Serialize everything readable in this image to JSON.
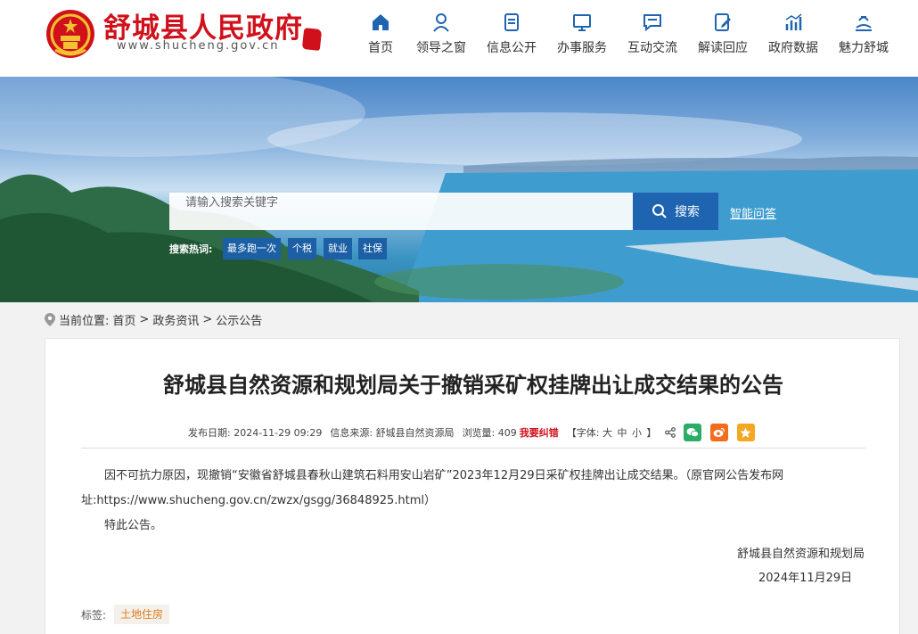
{
  "site": {
    "title": "舒城县人民政府",
    "domain": "www.shucheng.gov.cn",
    "seal_text": "舒城"
  },
  "nav": {
    "items": [
      {
        "label": "首页",
        "icon": "home-icon"
      },
      {
        "label": "领导之窗",
        "icon": "person-icon"
      },
      {
        "label": "信息公开",
        "icon": "document-icon"
      },
      {
        "label": "办事服务",
        "icon": "monitor-icon"
      },
      {
        "label": "互动交流",
        "icon": "chat-icon"
      },
      {
        "label": "解读回应",
        "icon": "edit-icon"
      },
      {
        "label": "政府数据",
        "icon": "chart-icon"
      },
      {
        "label": "魅力舒城",
        "icon": "landscape-icon"
      }
    ]
  },
  "search": {
    "placeholder": "请输入搜索关键字",
    "button_label": "搜索",
    "smart_qa": "智能问答",
    "hot_label": "搜索热词:",
    "hot_tags": [
      "最多跑一次",
      "个税",
      "就业",
      "社保"
    ]
  },
  "breadcrumb": {
    "prefix": "当前位置:",
    "items": [
      "首页",
      "政务资讯",
      "公示公告"
    ],
    "separator": ">"
  },
  "article": {
    "title": "舒城县自然资源和规划局关于撤销采矿权挂牌出让成交结果的公告",
    "meta": {
      "date_label": "发布日期:",
      "date": "2024-11-29 09:29",
      "source_label": "信息来源:",
      "source": "舒城县自然资源局",
      "views_label": "浏览量:",
      "views": "409",
      "correct": "我要纠错",
      "font_prefix": "【字体:",
      "font_large": "大",
      "font_medium": "中",
      "font_small": "小",
      "font_suffix": "】"
    },
    "body_p1": "因不可抗力原因，现撤销“安徽省舒城县春秋山建筑石料用安山岩矿”2023年12月29日采矿权挂牌出让成交结果。（原官网公告发布网址:https://www.shucheng.gov.cn/zwzx/gsgg/36848925.html）",
    "body_p2": "特此公告。",
    "sign_org": "舒城县自然资源和规划局",
    "sign_date": "2024年11月29日",
    "tags_label": "标签:",
    "tag": "土地住房"
  },
  "colors": {
    "brand_red": "#d0111b",
    "brand_blue": "#1e64b0",
    "tag_orange": "#e27a16",
    "wechat_green": "#2aae67",
    "weibo_orange": "#f36b1c",
    "favorite_yellow": "#f5a623"
  }
}
